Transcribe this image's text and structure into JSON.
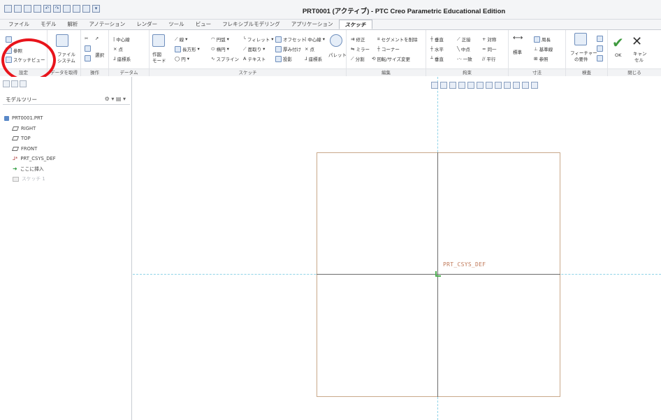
{
  "window": {
    "title": "PRT0001 (アクティブ) - PTC Creo Parametric Educational Edition"
  },
  "menu": {
    "tabs": [
      "ファイル",
      "モデル",
      "解析",
      "アノテーション",
      "レンダー",
      "ツール",
      "ビュー",
      "フレキシブルモデリング",
      "アプリケーション",
      "スケッチ"
    ],
    "active": "スケッチ"
  },
  "ribbon": {
    "setup": {
      "reference": "参照",
      "sketch_view": "スケッチビュー",
      "label": "設定"
    },
    "get_data": {
      "file_system_1": "ファイル",
      "file_system_2": "システム",
      "label": "データを取得"
    },
    "operations": {
      "select": "選択",
      "label": "操作"
    },
    "datum": {
      "centerline": "中心線",
      "point": "点",
      "csys": "座標系",
      "label": "データム"
    },
    "sketch": {
      "construction_mode_1": "作図",
      "construction_mode_2": "モード",
      "line": "線",
      "rectangle": "長方形",
      "circle": "円",
      "arc": "円弧",
      "ellipse": "楕円",
      "spline": "スプライン",
      "fillet": "フィレット",
      "chamfer": "面取り",
      "text": "テキスト",
      "offset": "オフセット",
      "thicken": "厚み付け",
      "project": "投影",
      "centerline": "中心線",
      "point": "点",
      "csys": "座標系",
      "palette": "パレット",
      "label": "スケッチ"
    },
    "editing": {
      "modify": "修正",
      "delete_segment": "セグメントを削除",
      "mirror": "ミラー",
      "corner": "コーナー",
      "divide": "分割",
      "rotate_resize": "回転/サイズ変更",
      "label": "編集"
    },
    "constrain": {
      "vertical": "垂直",
      "tangent": "正接",
      "symmetric": "対称",
      "horizontal": "水平",
      "midpoint": "中点",
      "equal": "同一",
      "perpendicular": "垂直",
      "coincident": "一致",
      "parallel": "平行",
      "label": "拘束"
    },
    "dimension": {
      "normal": "標準",
      "perimeter": "周長",
      "baseline": "基準線",
      "reference": "参照",
      "label": "寸法"
    },
    "inspect": {
      "feature_req_1": "フィーチャー",
      "feature_req_2": "の要件",
      "label": "検査"
    },
    "close": {
      "ok": "OK",
      "cancel_1": "キャン",
      "cancel_2": "セル",
      "label": "閉じる"
    }
  },
  "model_tree": {
    "header": "モデルツリー",
    "items": [
      {
        "label": "PRT0001.PRT",
        "icon": "part-icon"
      },
      {
        "label": "RIGHT",
        "icon": "datum-plane-icon"
      },
      {
        "label": "TOP",
        "icon": "datum-plane-icon"
      },
      {
        "label": "FRONT",
        "icon": "datum-plane-icon"
      },
      {
        "label": "PRT_CSYS_DEF",
        "icon": "csys-icon"
      },
      {
        "label": "ここに挿入",
        "icon": "insert-here-icon"
      },
      {
        "label": "スケッチ 1",
        "icon": "sketch-icon"
      }
    ]
  },
  "canvas": {
    "csys_label": "PRT_CSYS_DEF"
  },
  "colors": {
    "annotation": "#e8141b",
    "sketch_plane_border": "#c9a88a",
    "centerline_dash": "#8fd3e8",
    "ok_green": "#3f9a3f"
  }
}
